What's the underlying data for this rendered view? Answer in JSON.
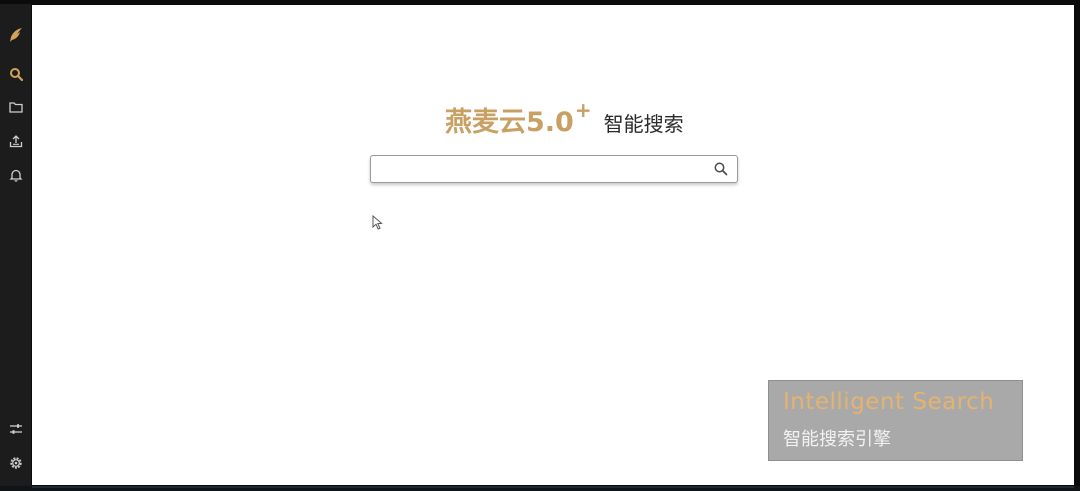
{
  "sidebar": {
    "items": [
      {
        "icon": "logo-feather-icon",
        "color": "#d4a25a"
      },
      {
        "icon": "search-icon",
        "color": "#d4a25a"
      },
      {
        "icon": "folder-icon",
        "color": "#cfcfcf"
      },
      {
        "icon": "upload-icon",
        "color": "#cfcfcf"
      },
      {
        "icon": "bell-icon",
        "color": "#cfcfcf"
      }
    ],
    "bottom_items": [
      {
        "icon": "sliders-icon",
        "color": "#cfcfcf"
      },
      {
        "icon": "gear-icon",
        "color": "#cfcfcf"
      }
    ]
  },
  "main": {
    "brand": "燕麦云5.0",
    "brand_plus": "+",
    "subtitle": "智能搜索",
    "search": {
      "value": "",
      "placeholder": ""
    }
  },
  "caption": {
    "english": "Intelligent Search",
    "chinese": "智能搜索引擎"
  },
  "colors": {
    "accent": "#c9a063",
    "sidebar_bg": "#1c1c1c",
    "caption_bg": "#a9a9a9",
    "caption_text_en": "#e6b36f"
  }
}
